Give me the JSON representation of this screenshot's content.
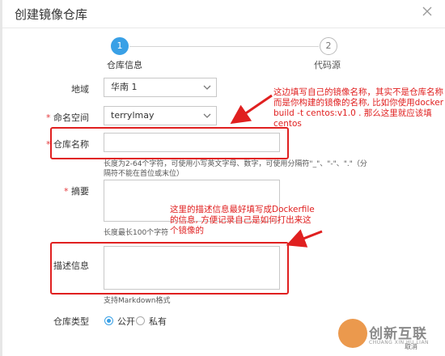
{
  "dialog": {
    "title": "创建镜像仓库",
    "close_icon": "close-icon"
  },
  "steps": [
    {
      "number": "1",
      "label": "仓库信息",
      "active": true
    },
    {
      "number": "2",
      "label": "代码源",
      "active": false
    }
  ],
  "form": {
    "region": {
      "label": "地域",
      "value": "华南 1"
    },
    "namespace": {
      "label": "命名空间",
      "required": "*",
      "value": "terrylmay"
    },
    "repo_name": {
      "label": "仓库名称",
      "required": "*",
      "value": "",
      "hint": "长度为2-64个字符，可使用小写英文字母、数字，可使用分隔符\"_\"、\"-\"、\".\"（分隔符不能在首位或末位）"
    },
    "summary": {
      "label": "摘要",
      "required": "*",
      "value": "",
      "hint": "长度最长100个字符"
    },
    "description": {
      "label": "描述信息",
      "value": "",
      "hint": "支持Markdown格式"
    },
    "repo_type": {
      "label": "仓库类型",
      "options": [
        {
          "label": "公开",
          "selected": true
        },
        {
          "label": "私有",
          "selected": false
        }
      ]
    }
  },
  "annotations": {
    "name_note": [
      "这边填写自己的镜像名称，其实不是仓库名称",
      "而是你构建的镜像的名称, 比如你使用docker",
      "build -t centos:v1.0 . 那么这里就应该填centos"
    ],
    "desc_note": [
      "这里的描述信息最好填写成Dockerfile",
      "的信息, 方便记录自己是如何打出来这",
      "个镜像的"
    ],
    "color": "#e02020"
  },
  "watermark": {
    "brand": "创新互联",
    "sub": "CHUANG XIN HU LIAN",
    "partial": "取消"
  },
  "colors": {
    "accent": "#39a0e6",
    "annotation": "#e02020"
  }
}
